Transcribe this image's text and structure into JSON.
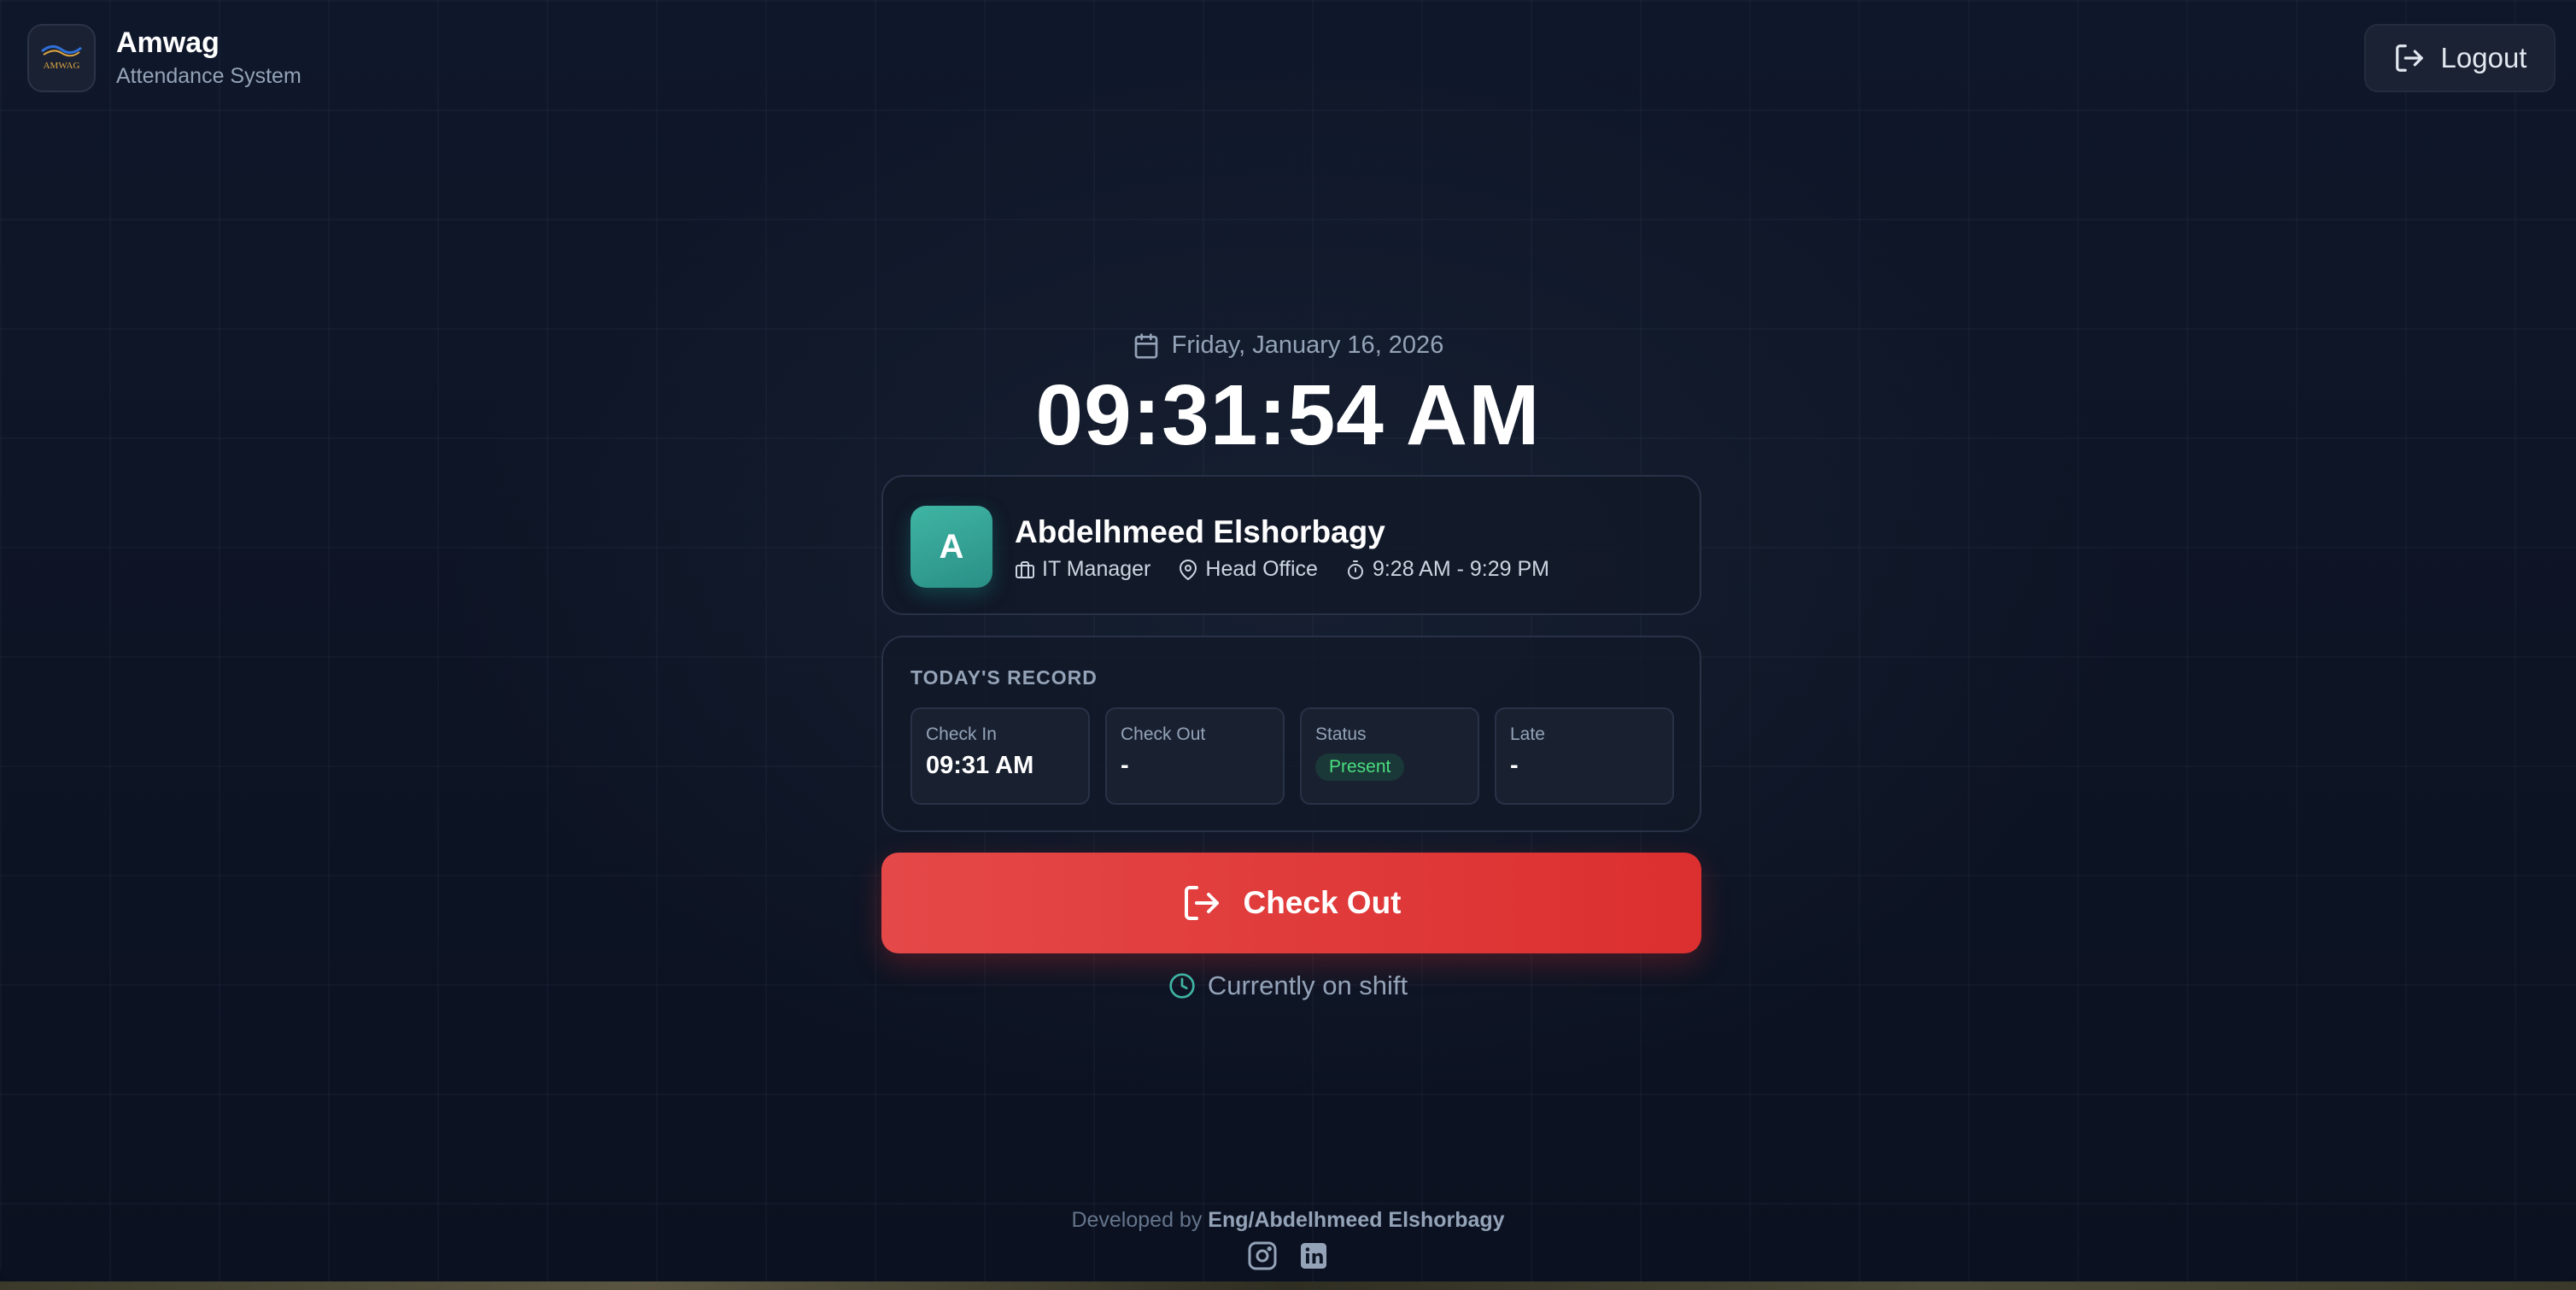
{
  "header": {
    "brand_name": "Amwag",
    "brand_subtitle": "Attendance System",
    "logo_text": "AMWAG",
    "logout_label": "Logout"
  },
  "clock": {
    "date": "Friday, January 16, 2026",
    "time": "09:31:54 AM"
  },
  "profile": {
    "avatar_initial": "A",
    "name": "Abdelhmeed Elshorbagy",
    "role": "IT Manager",
    "location": "Head Office",
    "shift_hours": "9:28 AM - 9:29 PM"
  },
  "record": {
    "title": "TODAY'S RECORD",
    "check_in_label": "Check In",
    "check_in_value": "09:31 AM",
    "check_out_label": "Check Out",
    "check_out_value": "-",
    "status_label": "Status",
    "status_value": "Present",
    "late_label": "Late",
    "late_value": "-"
  },
  "action": {
    "checkout_label": "Check Out",
    "shift_status": "Currently on shift"
  },
  "footer": {
    "developed_by": "Developed by",
    "developer": "Eng/Abdelhmeed Elshorbagy"
  },
  "colors": {
    "accent_red": "#dc2f2f",
    "accent_teal": "#3fb5a4",
    "status_green": "#4ade80",
    "background": "#0f172a"
  },
  "icons": {
    "logout": "logout-icon",
    "calendar": "calendar-icon",
    "briefcase": "briefcase-icon",
    "location": "map-pin-icon",
    "timer": "timer-icon",
    "checkout": "logout-icon",
    "clock": "clock-icon",
    "instagram": "instagram-icon",
    "linkedin": "linkedin-icon"
  }
}
